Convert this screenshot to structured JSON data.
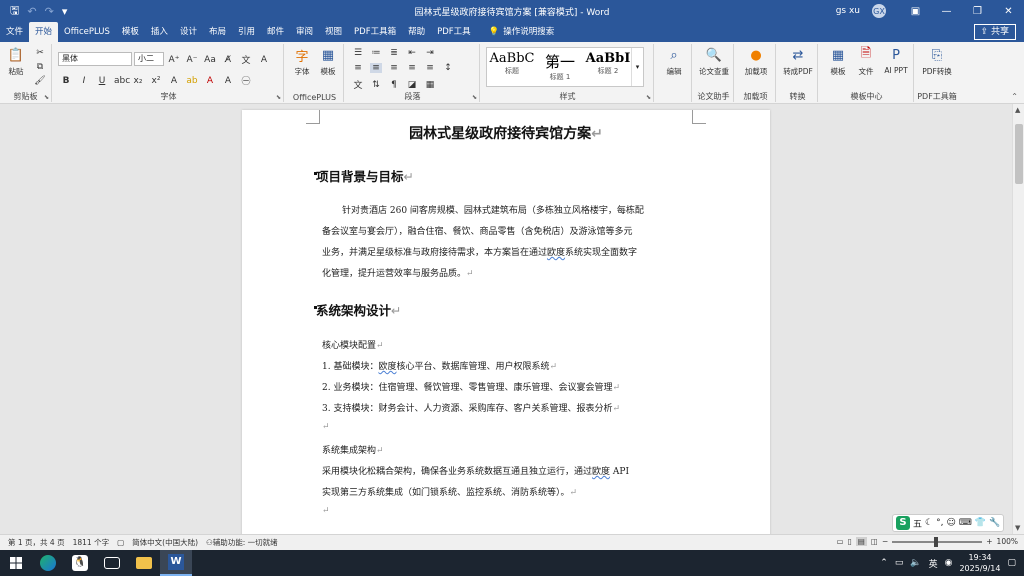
{
  "window": {
    "title": "园林式星级政府接待宾馆方案 [兼容模式] - Word",
    "user": "gs xu",
    "avatar_initials": "GX",
    "min_icon": "minimize-icon",
    "accent": "#2b579a"
  },
  "tabs": [
    "文件",
    "开始",
    "OfficePLUS",
    "模板",
    "插入",
    "设计",
    "布局",
    "引用",
    "邮件",
    "审阅",
    "视图",
    "PDF工具箱",
    "帮助",
    "PDF工具"
  ],
  "active_tab": "开始",
  "search_tab": "操作说明搜索",
  "share_label": "共享",
  "ribbon": {
    "clipboard": {
      "paste": "粘贴",
      "label": "剪贴板"
    },
    "font": {
      "name": "黑体",
      "size": "小二",
      "label": "字体"
    },
    "officeplus": {
      "btn1": "字体",
      "btn2": "模板",
      "label": "OfficePLUS"
    },
    "paragraph": {
      "label": "段落"
    },
    "styles": {
      "items": [
        {
          "preview": "AaBbC",
          "name": "标题"
        },
        {
          "preview": "第一",
          "name": "标题 1"
        },
        {
          "preview": "AaBbI",
          "name": "标题 2"
        }
      ],
      "label": "样式"
    },
    "editing": {
      "btn": "编辑",
      "label": ""
    },
    "review": {
      "btn": "论文查重",
      "label": "论文助手"
    },
    "addins": {
      "btn": "加载项",
      "label": "加载项"
    },
    "convert": {
      "btn": "转成PDF",
      "label": "转换"
    },
    "templates": {
      "btn1": "模板",
      "btn2": "文件",
      "btn3": "AI PPT",
      "label": "模板中心"
    },
    "pdf": {
      "btn": "PDF转换",
      "label": "PDF工具箱"
    }
  },
  "document": {
    "title": "园林式星级政府接待宾馆方案",
    "sections": [
      {
        "heading": "项目背景与目标",
        "lines": [
          "针对贵酒店 260 间客房规模、园林式建筑布局（多栋独立风格楼宇，每栋配",
          "备会议室与宴会厅），融合住宿、餐饮、商品零售（含免税店）及游泳馆等多元",
          "业务，并满足星级标准与政府接待需求，本方案旨在通过欧度系统实现全面数字",
          "化管理，提升运营效率与服务品质。"
        ]
      },
      {
        "heading": "系统架构设计",
        "lines": [
          "核心模块配置",
          "1.  基础模块：欧度核心平台、数据库管理、用户权限系统",
          "2.  业务模块：住宿管理、餐饮管理、零售管理、康乐管理、会议宴会管理",
          "3.  支持模块：财务会计、人力资源、采购库存、客户关系管理、报表分析",
          "",
          "  系统集成架构",
          "采用模块化松耦合架构，确保各业务系统数据互通且独立运行，通过欧度 API",
          "实现第三方系统集成（如门锁系统、监控系统、消防系统等）。",
          ""
        ]
      }
    ]
  },
  "status": {
    "page": "第 1 页，共 4 页",
    "words": "1811 个字",
    "lang": "简体中文(中国大陆)",
    "accessibility": "辅助功能: 一切就绪",
    "zoom": "100%"
  },
  "taskbar": {
    "time": "19:34",
    "date": "2025/9/14",
    "ime_char": "五"
  }
}
